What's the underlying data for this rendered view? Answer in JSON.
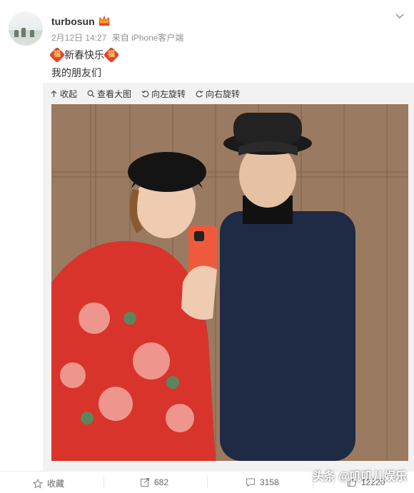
{
  "post": {
    "username": "turbosun",
    "date": "2月12日 14:27",
    "source": "来自 iPhone客户端",
    "line1": "新春快乐",
    "line2": "我的朋友们",
    "fu_char": "福"
  },
  "toolbar": {
    "collapse": "收起",
    "view_large": "查看大图",
    "rotate_left": "向左旋转",
    "rotate_right": "向右旋转"
  },
  "footer": {
    "favorite": "收藏",
    "repost_count": "682",
    "comment_count": "3158",
    "like_count": "12220"
  },
  "watermark": "头条 @叽叽儿娱乐",
  "colors": {
    "accent_red": "#e8442a",
    "meta_gray": "#939393",
    "panel_bg": "#f2f2f2"
  }
}
